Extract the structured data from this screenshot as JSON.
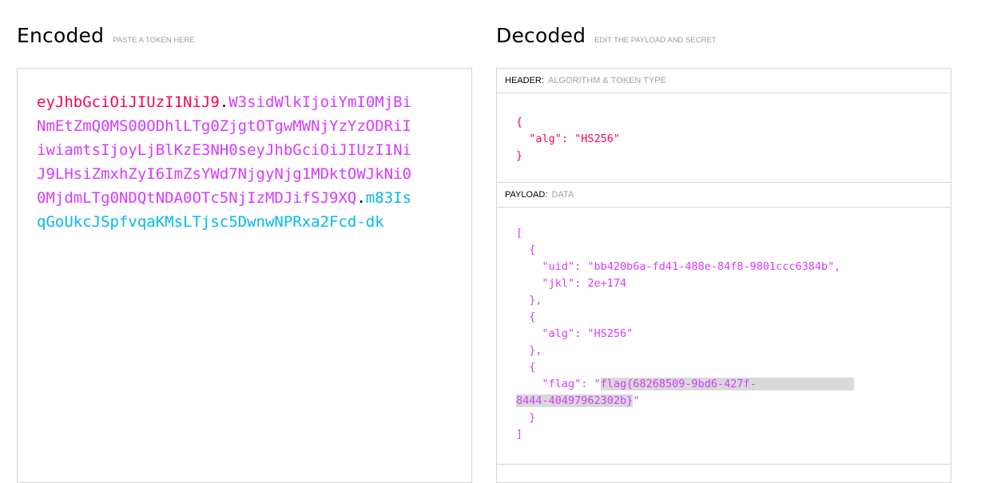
{
  "encoded": {
    "title": "Encoded",
    "subtitle": "PASTE A TOKEN HERE",
    "token_header": "eyJhbGciOiJIUzI1NiJ9",
    "token_payload": "W3sidWlkIjoiYmI0MjBiNmEtZmQ0MS00ODhlLTg0ZjgtOTgwMWNjYzYzODRiIiwiamtsIjoyLjBlKzE3NH0seyJhbGciOiJIUzI1NiJ9LHsiZmxhZyI6ImZsYWd7NjgyNjg1MDktOWJkNi00MjdmLTg0NDQtNDA0OTc5NjIzMDJifSJ9XQ",
    "token_signature": "m83IsqGoUkcJSpfvqaKMsLTjsc5DwnwNPRxa2Fcd-dk",
    "dot": "."
  },
  "decoded": {
    "title": "Decoded",
    "subtitle": "EDIT THE PAYLOAD AND SECRET",
    "header_section": {
      "label": "HEADER:",
      "sublabel": "ALGORITHM & TOKEN TYPE",
      "lines": [
        "{",
        "  \"alg\": \"HS256\"",
        "}"
      ]
    },
    "payload_section": {
      "label": "PAYLOAD:",
      "sublabel": "DATA",
      "lines": [
        "[",
        "  {",
        "    \"uid\": \"bb420b6a-fd41-488e-84f8-9801ccc6384b\",",
        "    \"jkl\": 2e+174",
        "  },",
        "  {",
        "    \"alg\": \"HS256\"",
        "  },",
        "  {"
      ],
      "flag_prefix": "    \"flag\": \"",
      "flag_value": "flag{68268509-9bd6-427f-8444-40497962302b}",
      "flag_suffix": "\"",
      "closing_lines": [
        "  }",
        "]"
      ]
    }
  }
}
